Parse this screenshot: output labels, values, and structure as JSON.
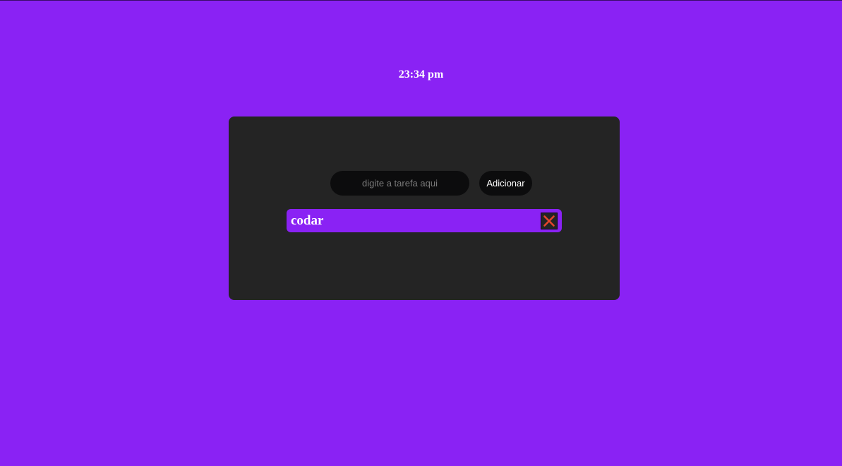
{
  "clock": {
    "time": "23:34 pm"
  },
  "todo": {
    "input_placeholder": "digite a tarefa aqui",
    "input_value": "",
    "add_label": "Adicionar",
    "tasks": [
      {
        "text": "codar",
        "delete_icon": "close-x-icon"
      }
    ]
  },
  "colors": {
    "background": "#8a22f4",
    "panel": "#242424",
    "control": "#0c0c0d",
    "task_item": "#8a22f4",
    "delete_x": "#e8452c"
  }
}
